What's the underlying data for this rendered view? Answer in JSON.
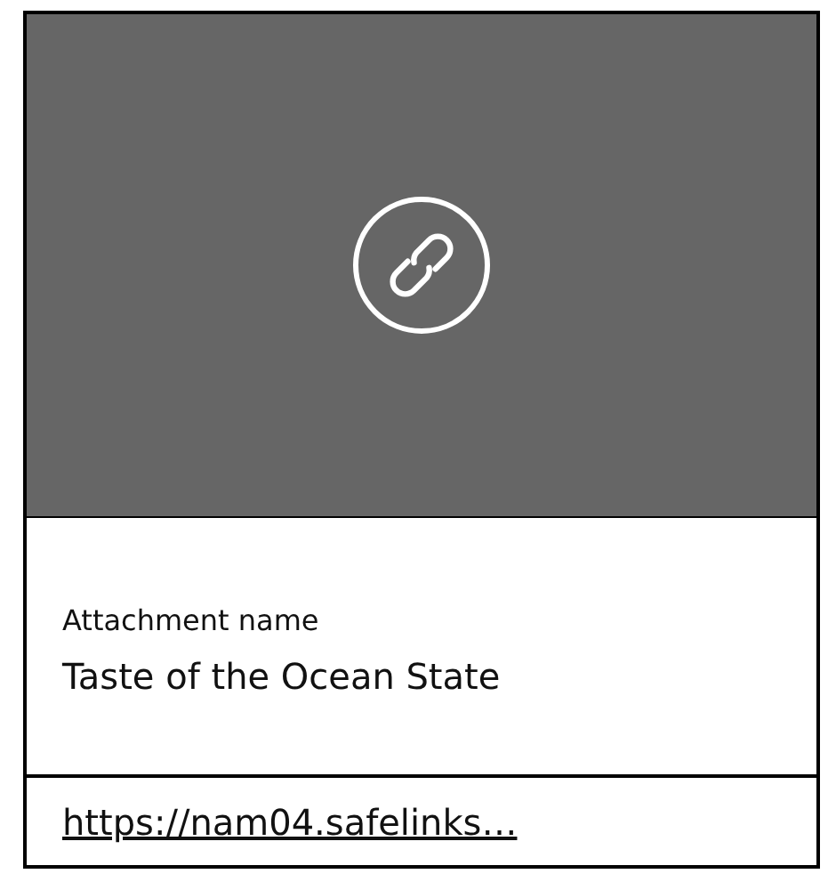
{
  "preview": {
    "kind": "link"
  },
  "attachment": {
    "label": "Attachment name",
    "name": "Taste of the Ocean State"
  },
  "link": {
    "text": "https://nam04.safelinks…"
  }
}
